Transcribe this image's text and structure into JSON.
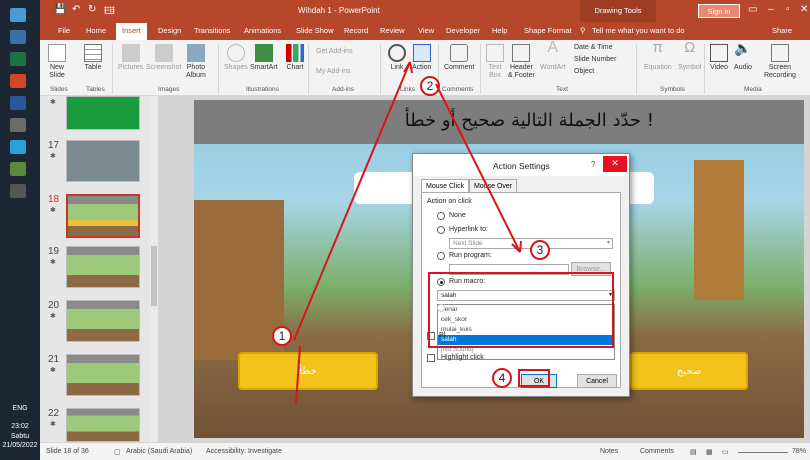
{
  "taskbar": {
    "lang": "ENG",
    "time": "23:02",
    "day": "Sabtu",
    "date": "21/05/2022"
  },
  "titlebar": {
    "title": "Wihdah 1 - PowerPoint",
    "context_tab": "Drawing Tools",
    "signin": "Sign in",
    "qat_save": "💾",
    "qat_undo": "↶",
    "qat_redo": "↻",
    "qat_more": "🖽"
  },
  "tabs": [
    "File",
    "Home",
    "Insert",
    "Design",
    "Transitions",
    "Animations",
    "Slide Show",
    "Record",
    "Review",
    "View",
    "Developer",
    "Help",
    "Shape Format",
    "Tell me what you want to do",
    "Share"
  ],
  "ribbon": {
    "new_slide": "New\nSlide",
    "table": "Table",
    "pictures": "Pictures",
    "screenshot": "Screenshot",
    "photo_album": "Photo\nAlbum",
    "shapes": "Shapes",
    "smartart": "SmartArt",
    "chart": "Chart",
    "get_addins": "Get Add-ins",
    "my_addins": "My Add-ins",
    "link": "Link",
    "action": "Action",
    "comment": "Comment",
    "text_box": "Text\nBox",
    "header_footer": "Header\n& Footer",
    "wordart": "WordArt",
    "date_time": "Date & Time",
    "slide_number": "Slide Number",
    "object": "Object",
    "equation": "Equation",
    "symbol": "Symbol",
    "video": "Video",
    "audio": "Audio",
    "screen_recording": "Screen\nRecording",
    "groups": {
      "slides": "Slides",
      "tables": "Tables",
      "images": "Images",
      "illustrations": "Illustrations",
      "addins": "Add-ins",
      "links": "Links",
      "comments": "Comments",
      "text": "Text",
      "symbols": "Symbols",
      "media": "Media"
    }
  },
  "thumbnails": [
    {
      "num": "17"
    },
    {
      "num": "18"
    },
    {
      "num": "19"
    },
    {
      "num": "20"
    },
    {
      "num": "21"
    },
    {
      "num": "22"
    }
  ],
  "slide": {
    "question": "حدّد الجملة التالية صحيح أو خطأ !",
    "btn_false": "خطأ",
    "btn_true": "صحيح"
  },
  "dialog": {
    "title": "Action Settings",
    "help": "?",
    "close": "✕",
    "tab_mouse_click": "Mouse Click",
    "tab_mouse_over": "Mouse Over",
    "action_on_click": "Action on click",
    "none": "None",
    "hyperlink_to": "Hyperlink to:",
    "hyperlink_value": "Next Slide",
    "run_program": "Run program:",
    "browse": "Browse...",
    "run_macro": "Run macro:",
    "macro_value": "salah",
    "macros": [
      "benar",
      "cek_skor",
      "mulai_kuis",
      "salah",
      "[No Sound]"
    ],
    "object_action": "Pl",
    "highlight_click": "Highlight click",
    "ok": "OK",
    "cancel": "Cancel"
  },
  "annotations": [
    "1",
    "2",
    "3",
    "4"
  ],
  "status": {
    "slide_of": "Slide 18 of 36",
    "language": "Arabic (Saudi Arabia)",
    "accessibility": "Accessibility: Investigate",
    "notes": "Notes",
    "comments": "Comments",
    "zoom": "78%"
  },
  "colors": {
    "accent": "#b7472a",
    "highlight": "#d8151c",
    "button_yellow": "#f2c21b"
  }
}
